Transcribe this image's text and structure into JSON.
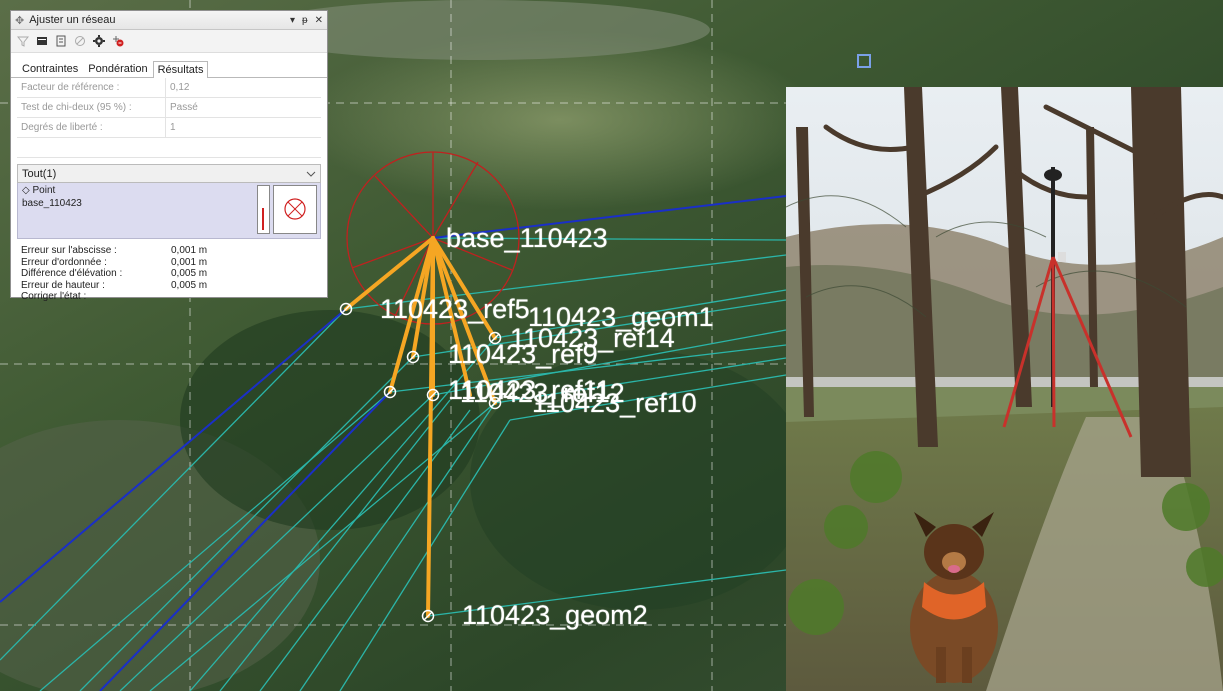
{
  "panel": {
    "title": "Ajuster un réseau",
    "controls": {
      "dropdown": "▾",
      "pin": "ᵽ",
      "close": "✕"
    },
    "tabs": [
      {
        "label": "Contraintes",
        "active": false
      },
      {
        "label": "Pondération",
        "active": false
      },
      {
        "label": "Résultats",
        "active": true
      }
    ],
    "results": [
      {
        "label": "Facteur de référence :",
        "value": "0,12"
      },
      {
        "label": "Test de chi-deux (95 %) :",
        "value": "Passé"
      },
      {
        "label": "Degrés de liberté :",
        "value": "1"
      }
    ],
    "filter_value": "Tout(1)",
    "point": {
      "type": "Point",
      "name": "base_110423"
    },
    "errors": [
      {
        "label": "Erreur sur l'abscisse :",
        "value": "0,001 m"
      },
      {
        "label": "Erreur d'ordonnée :",
        "value": "0,001 m"
      },
      {
        "label": "Différence d'élévation :",
        "value": "0,005 m"
      },
      {
        "label": "Erreur de hauteur :",
        "value": "0,005 m"
      },
      {
        "label": "Corriger l'état :",
        "value": ""
      }
    ]
  },
  "map": {
    "labels": {
      "base": "base_110423",
      "ref5": "110423_ref5",
      "geom1": "110423_geom1",
      "ref14": "110423_ref14",
      "ref9": "110423_ref9",
      "ref11": "110423_ref11",
      "ref12": "110423_ref12",
      "ref10": "110423_ref10",
      "geom2": "110423_geom2"
    },
    "colors": {
      "observation": "#f5a623",
      "baseline": "#1a2fc8",
      "gnss_vector": "#2bb5a8",
      "error_ellipse": "#c0211f"
    }
  }
}
